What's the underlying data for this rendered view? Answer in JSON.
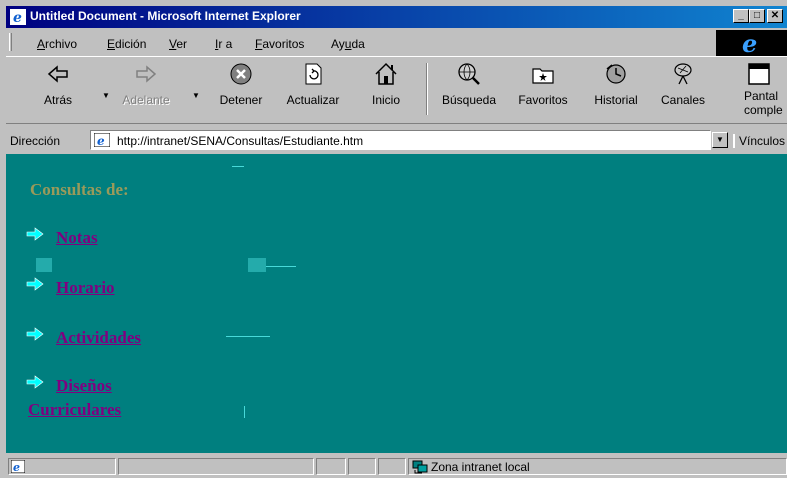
{
  "window": {
    "title": "Untitled Document - Microsoft Internet Explorer",
    "controls": {
      "minimize": "_",
      "maximize": "□",
      "close": "✕"
    }
  },
  "menu": {
    "items": [
      {
        "prefix": "",
        "key": "A",
        "rest": "rchivo"
      },
      {
        "prefix": "",
        "key": "E",
        "rest": "dición"
      },
      {
        "prefix": "",
        "key": "V",
        "rest": "er"
      },
      {
        "prefix": "",
        "key": "I",
        "rest": "r a"
      },
      {
        "prefix": "",
        "key": "F",
        "rest": "avoritos"
      },
      {
        "prefix": "Ay",
        "key": "u",
        "rest": "da"
      }
    ]
  },
  "toolbar": {
    "back": "Atrás",
    "forward": "Adelante",
    "stop": "Detener",
    "refresh": "Actualizar",
    "home": "Inicio",
    "search": "Búsqueda",
    "favorites": "Favoritos",
    "history": "Historial",
    "channels": "Canales",
    "fullscreen_line1": "Pantal",
    "fullscreen_line2": "comple"
  },
  "address": {
    "label": "Dirección",
    "url": "http://intranet/SENA/Consultas/Estudiante.htm",
    "links_label": "Vínculos"
  },
  "content": {
    "heading": "Consultas de:",
    "links": {
      "notas": "Notas",
      "horario": "Horario",
      "actividades": "Actividades",
      "disenos_line1": "Diseños",
      "disenos_line2": "Curriculares"
    }
  },
  "status": {
    "zone": "Zona intranet local"
  },
  "colors": {
    "content_bg": "#007f7f",
    "heading": "#9a9a5a",
    "link": "#800080",
    "arrow": "#00ffff"
  }
}
